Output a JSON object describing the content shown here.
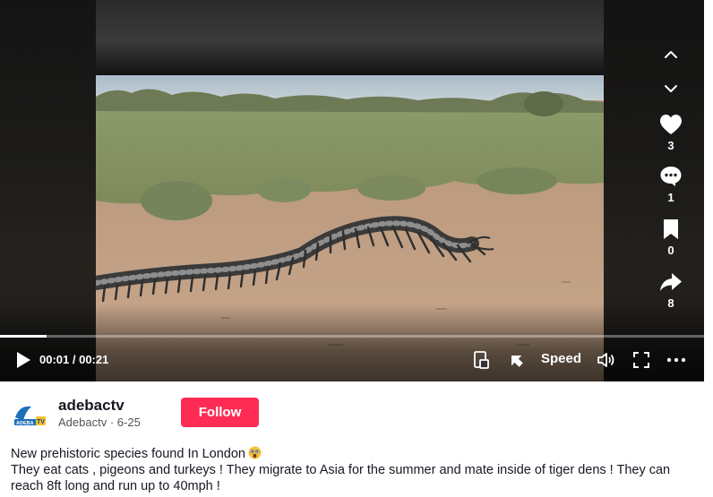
{
  "player": {
    "time": "00:01 / 00:21",
    "speed_label": "Speed",
    "progress": 0.066
  },
  "actions": {
    "likes": "3",
    "comments": "1",
    "saves": "0",
    "shares": "8"
  },
  "author": {
    "name": "adebactv",
    "nickname": "Adebactv",
    "date": "6-25",
    "avatar_text": "ADEBA TV"
  },
  "follow_label": "Follow",
  "description": {
    "line1": "New prehistoric species found In London",
    "line2": "They eat cats , pigeons and turkeys ! They migrate to Asia for the summer and mate inside of tiger dens ! They can reach 8ft long and run up to 40mph !"
  },
  "icons": {
    "up": "chevron-up-icon",
    "down": "chevron-down-icon",
    "like": "heart-icon",
    "comment": "comment-icon",
    "save": "bookmark-icon",
    "share": "share-arrow-icon",
    "play": "play-icon",
    "pip": "picture-in-picture-icon",
    "cast": "cast-icon",
    "volume": "volume-icon",
    "fullscreen": "fullscreen-icon",
    "more": "more-dots-icon"
  },
  "colors": {
    "follow": "#fe2c55",
    "text": "#161823",
    "subtext": "#545454"
  }
}
